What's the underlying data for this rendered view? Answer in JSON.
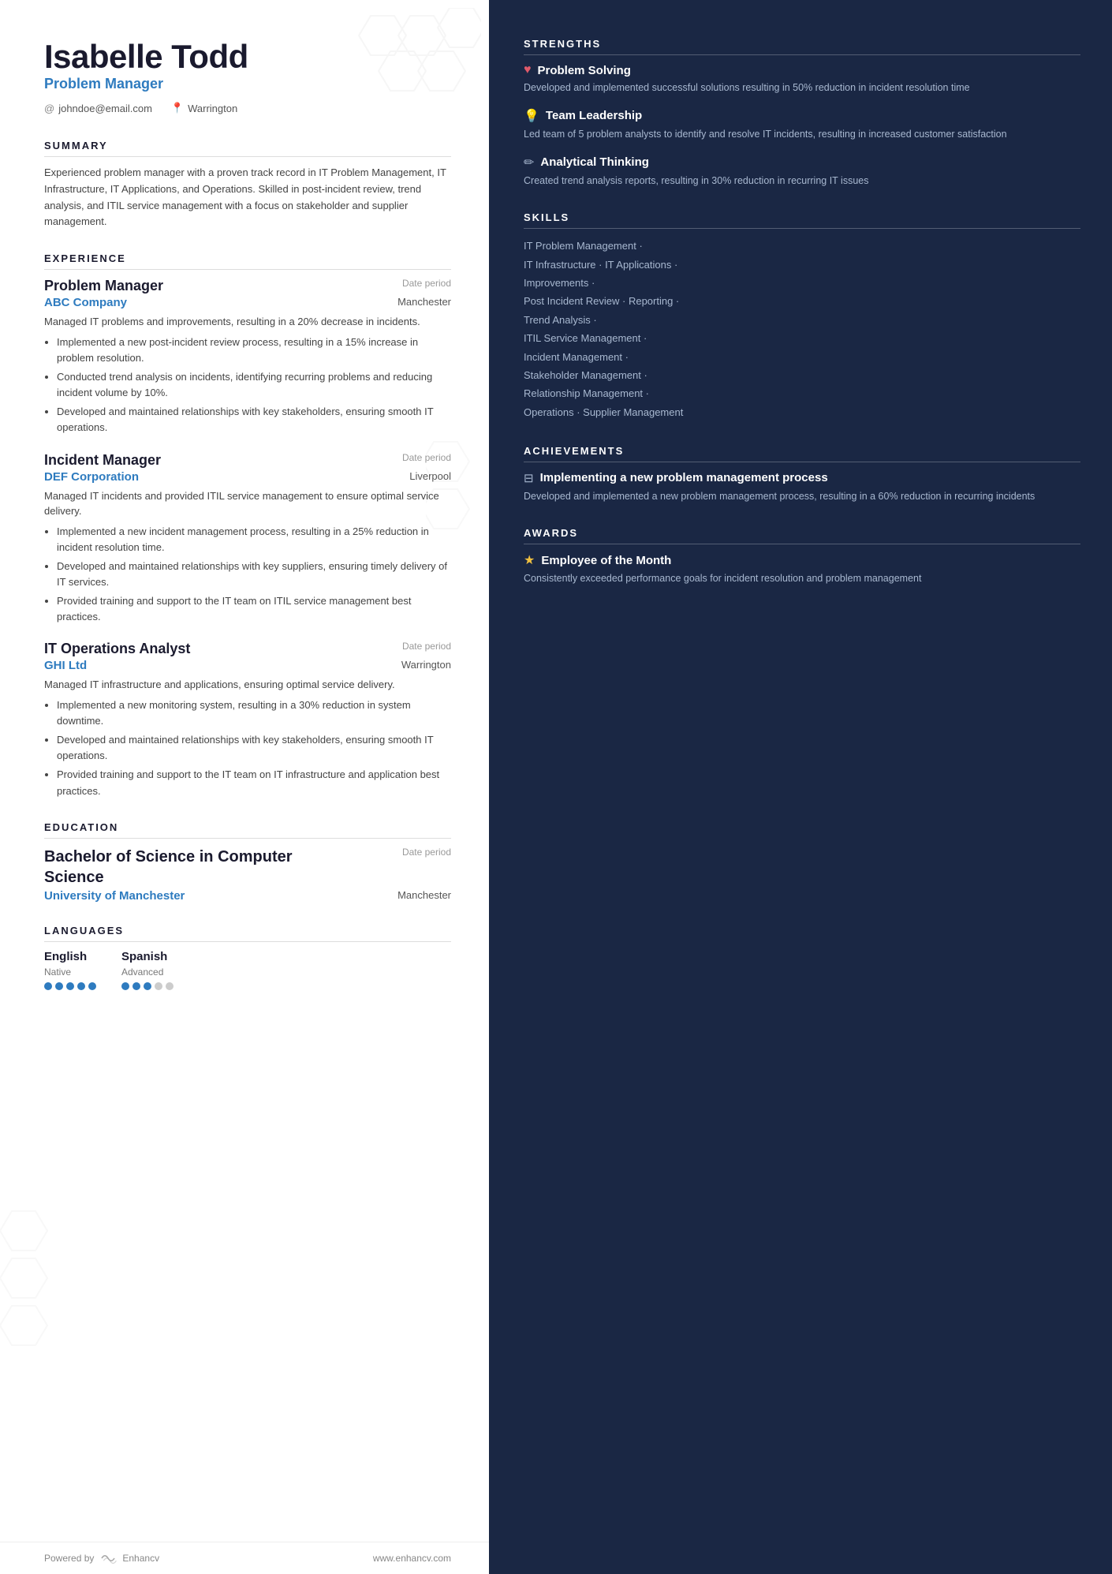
{
  "person": {
    "name": "Isabelle Todd",
    "title": "Problem Manager",
    "email": "johndoe@email.com",
    "location": "Warrington"
  },
  "summary": {
    "heading": "SUMMARY",
    "text": "Experienced problem manager with a proven track record in IT Problem Management, IT Infrastructure, IT Applications, and Operations. Skilled in post-incident review, trend analysis, and ITIL service management with a focus on stakeholder and supplier management."
  },
  "experience": {
    "heading": "EXPERIENCE",
    "jobs": [
      {
        "title": "Problem Manager",
        "company": "ABC Company",
        "date": "Date period",
        "location": "Manchester",
        "summary": "Managed IT problems and improvements, resulting in a 20% decrease in incidents.",
        "bullets": [
          "Implemented a new post-incident review process, resulting in a 15% increase in problem resolution.",
          "Conducted trend analysis on incidents, identifying recurring problems and reducing incident volume by 10%.",
          "Developed and maintained relationships with key stakeholders, ensuring smooth IT operations."
        ]
      },
      {
        "title": "Incident Manager",
        "company": "DEF Corporation",
        "date": "Date period",
        "location": "Liverpool",
        "summary": "Managed IT incidents and provided ITIL service management to ensure optimal service delivery.",
        "bullets": [
          "Implemented a new incident management process, resulting in a 25% reduction in incident resolution time.",
          "Developed and maintained relationships with key suppliers, ensuring timely delivery of IT services.",
          "Provided training and support to the IT team on ITIL service management best practices."
        ]
      },
      {
        "title": "IT Operations Analyst",
        "company": "GHI Ltd",
        "date": "Date period",
        "location": "Warrington",
        "summary": "Managed IT infrastructure and applications, ensuring optimal service delivery.",
        "bullets": [
          "Implemented a new monitoring system, resulting in a 30% reduction in system downtime.",
          "Developed and maintained relationships with key stakeholders, ensuring smooth IT operations.",
          "Provided training and support to the IT team on IT infrastructure and application best practices."
        ]
      }
    ]
  },
  "education": {
    "heading": "EDUCATION",
    "degree": "Bachelor of Science in Computer Science",
    "school": "University of Manchester",
    "date": "Date period",
    "location": "Manchester"
  },
  "languages": {
    "heading": "LANGUAGES",
    "items": [
      {
        "name": "English",
        "level": "Native",
        "filled": 5,
        "total": 5
      },
      {
        "name": "Spanish",
        "level": "Advanced",
        "filled": 3,
        "total": 5
      }
    ]
  },
  "footer": {
    "powered_by": "Powered by",
    "brand": "Enhancv",
    "website": "www.enhancv.com"
  },
  "strengths": {
    "heading": "STRENGTHS",
    "items": [
      {
        "icon": "♥",
        "name": "Problem Solving",
        "desc": "Developed and implemented successful solutions resulting in 50% reduction in incident resolution time"
      },
      {
        "icon": "💡",
        "name": "Team Leadership",
        "desc": "Led team of 5 problem analysts to identify and resolve IT incidents, resulting in increased customer satisfaction"
      },
      {
        "icon": "✏",
        "name": "Analytical Thinking",
        "desc": "Created trend analysis reports, resulting in 30% reduction in recurring IT issues"
      }
    ]
  },
  "skills": {
    "heading": "SKILLS",
    "lines": [
      "IT Problem Management ·",
      "IT Infrastructure · IT Applications ·",
      "Improvements ·",
      "Post Incident Review · Reporting ·",
      "Trend Analysis ·",
      "ITIL Service Management ·",
      "Incident Management ·",
      "Stakeholder Management ·",
      "Relationship Management ·",
      "Operations · Supplier Management"
    ]
  },
  "achievements": {
    "heading": "ACHIEVEMENTS",
    "items": [
      {
        "icon": "⊟",
        "name": "Implementing a new problem management process",
        "desc": "Developed and implemented a new problem management process, resulting in a 60% reduction in recurring incidents"
      }
    ]
  },
  "awards": {
    "heading": "AWARDS",
    "items": [
      {
        "icon": "★",
        "name": "Employee of the Month",
        "desc": "Consistently exceeded performance goals for incident resolution and problem management"
      }
    ]
  }
}
